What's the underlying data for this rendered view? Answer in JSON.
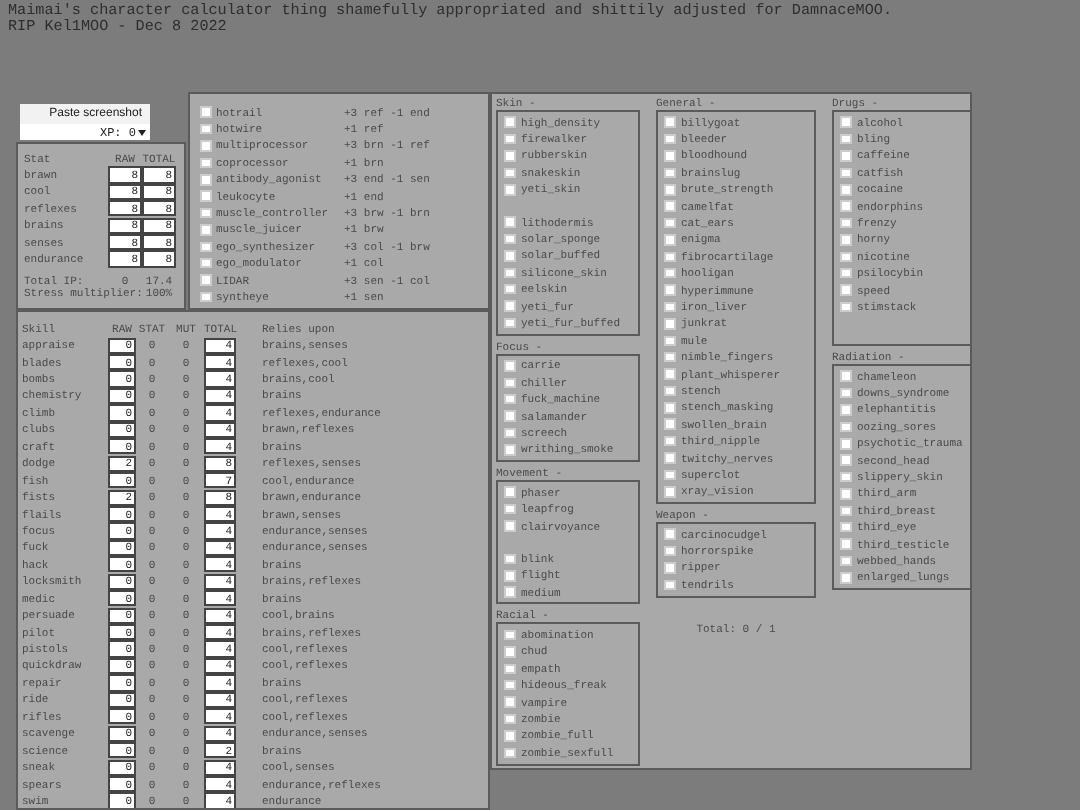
{
  "header": [
    "Maimai's character calculator thing shamefully appropriated and shittily adjusted for DamnaceMOO.",
    "RIP Kel1MOO - Dec 8 2022"
  ],
  "paste_button": "Paste screenshot",
  "xp_select": {
    "value": "XP: 0"
  },
  "stats": {
    "columns": [
      "Stat",
      "RAW",
      "TOTAL"
    ],
    "rows": [
      {
        "name": "brawn",
        "raw": "8",
        "total": "8"
      },
      {
        "name": "cool",
        "raw": "8",
        "total": "8"
      },
      {
        "name": "reflexes",
        "raw": "8",
        "total": "8"
      },
      {
        "name": "brains",
        "raw": "8",
        "total": "8"
      },
      {
        "name": "senses",
        "raw": "8",
        "total": "8"
      },
      {
        "name": "endurance",
        "raw": "8",
        "total": "8"
      }
    ],
    "total_ip": {
      "label": "Total IP:",
      "raw": "0",
      "total": "17.4"
    },
    "stress": {
      "label": "Stress multiplier:",
      "value": "100%"
    }
  },
  "implants": [
    {
      "name": "hotrail",
      "effect": "+3 ref -1 end",
      "checked": false
    },
    {
      "name": "hotwire",
      "effect": "+1 ref",
      "checked": false
    },
    {
      "name": "multiprocessor",
      "effect": "+3 brn -1 ref",
      "checked": false
    },
    {
      "name": "coprocessor",
      "effect": "+1 brn",
      "checked": false
    },
    {
      "name": "antibody_agonist",
      "effect": "+3 end -1 sen",
      "checked": false
    },
    {
      "name": "leukocyte",
      "effect": "+1 end",
      "checked": false
    },
    {
      "name": "muscle_controller",
      "effect": "+3 brw -1 brn",
      "checked": false
    },
    {
      "name": "muscle_juicer",
      "effect": "+1 brw",
      "checked": false
    },
    {
      "name": "ego_synthesizer",
      "effect": "+3 col -1 brw",
      "checked": false
    },
    {
      "name": "ego_modulator",
      "effect": "+1 col",
      "checked": false
    },
    {
      "name": "LIDAR",
      "effect": "+3 sen -1 col",
      "checked": false
    },
    {
      "name": "syntheye",
      "effect": "+1 sen",
      "checked": false
    }
  ],
  "skills": {
    "columns": [
      "Skill",
      "RAW",
      "STAT",
      "MUT",
      "TOTAL",
      "Relies upon"
    ],
    "rows": [
      {
        "name": "appraise",
        "raw": "0",
        "stat": "0",
        "mut": "0",
        "total": "4",
        "relies": "brains,senses"
      },
      {
        "name": "blades",
        "raw": "0",
        "stat": "0",
        "mut": "0",
        "total": "4",
        "relies": "reflexes,cool"
      },
      {
        "name": "bombs",
        "raw": "0",
        "stat": "0",
        "mut": "0",
        "total": "4",
        "relies": "brains,cool"
      },
      {
        "name": "chemistry",
        "raw": "0",
        "stat": "0",
        "mut": "0",
        "total": "4",
        "relies": "brains"
      },
      {
        "name": "climb",
        "raw": "0",
        "stat": "0",
        "mut": "0",
        "total": "4",
        "relies": "reflexes,endurance"
      },
      {
        "name": "clubs",
        "raw": "0",
        "stat": "0",
        "mut": "0",
        "total": "4",
        "relies": "brawn,reflexes"
      },
      {
        "name": "craft",
        "raw": "0",
        "stat": "0",
        "mut": "0",
        "total": "4",
        "relies": "brains"
      },
      {
        "name": "dodge",
        "raw": "2",
        "stat": "0",
        "mut": "0",
        "total": "8",
        "relies": "reflexes,senses"
      },
      {
        "name": "fish",
        "raw": "0",
        "stat": "0",
        "mut": "0",
        "total": "7",
        "relies": "cool,endurance"
      },
      {
        "name": "fists",
        "raw": "2",
        "stat": "0",
        "mut": "0",
        "total": "8",
        "relies": "brawn,endurance"
      },
      {
        "name": "flails",
        "raw": "0",
        "stat": "0",
        "mut": "0",
        "total": "4",
        "relies": "brawn,senses"
      },
      {
        "name": "focus",
        "raw": "0",
        "stat": "0",
        "mut": "0",
        "total": "4",
        "relies": "endurance,senses"
      },
      {
        "name": "fuck",
        "raw": "0",
        "stat": "0",
        "mut": "0",
        "total": "4",
        "relies": "endurance,senses"
      },
      {
        "name": "hack",
        "raw": "0",
        "stat": "0",
        "mut": "0",
        "total": "4",
        "relies": "brains"
      },
      {
        "name": "locksmith",
        "raw": "0",
        "stat": "0",
        "mut": "0",
        "total": "4",
        "relies": "brains,reflexes"
      },
      {
        "name": "medic",
        "raw": "0",
        "stat": "0",
        "mut": "0",
        "total": "4",
        "relies": "brains"
      },
      {
        "name": "persuade",
        "raw": "0",
        "stat": "0",
        "mut": "0",
        "total": "4",
        "relies": "cool,brains"
      },
      {
        "name": "pilot",
        "raw": "0",
        "stat": "0",
        "mut": "0",
        "total": "4",
        "relies": "brains,reflexes"
      },
      {
        "name": "pistols",
        "raw": "0",
        "stat": "0",
        "mut": "0",
        "total": "4",
        "relies": "cool,reflexes"
      },
      {
        "name": "quickdraw",
        "raw": "0",
        "stat": "0",
        "mut": "0",
        "total": "4",
        "relies": "cool,reflexes"
      },
      {
        "name": "repair",
        "raw": "0",
        "stat": "0",
        "mut": "0",
        "total": "4",
        "relies": "brains"
      },
      {
        "name": "ride",
        "raw": "0",
        "stat": "0",
        "mut": "0",
        "total": "4",
        "relies": "cool,reflexes"
      },
      {
        "name": "rifles",
        "raw": "0",
        "stat": "0",
        "mut": "0",
        "total": "4",
        "relies": "cool,reflexes"
      },
      {
        "name": "scavenge",
        "raw": "0",
        "stat": "0",
        "mut": "0",
        "total": "4",
        "relies": "endurance,senses"
      },
      {
        "name": "science",
        "raw": "0",
        "stat": "0",
        "mut": "0",
        "total": "2",
        "relies": "brains"
      },
      {
        "name": "sneak",
        "raw": "0",
        "stat": "0",
        "mut": "0",
        "total": "4",
        "relies": "cool,senses"
      },
      {
        "name": "spears",
        "raw": "0",
        "stat": "0",
        "mut": "0",
        "total": "4",
        "relies": "endurance,reflexes"
      },
      {
        "name": "swim",
        "raw": "0",
        "stat": "0",
        "mut": "0",
        "total": "4",
        "relies": "endurance"
      }
    ]
  },
  "mutations": {
    "columns": [
      [
        {
          "label": "Skin -",
          "groups": [
            [
              {
                "name": "high_density",
                "checked": false
              },
              {
                "name": "firewalker",
                "checked": false
              },
              {
                "name": "rubberskin",
                "checked": false
              },
              {
                "name": "snakeskin",
                "checked": false
              },
              {
                "name": "yeti_skin",
                "checked": false
              }
            ],
            [
              {
                "name": "lithodermis",
                "checked": false
              },
              {
                "name": "solar_sponge",
                "checked": false
              },
              {
                "name": "solar_buffed",
                "checked": false
              },
              {
                "name": "silicone_skin",
                "checked": false
              },
              {
                "name": "eelskin",
                "checked": false
              },
              {
                "name": "yeti_fur",
                "checked": false
              },
              {
                "name": "yeti_fur_buffed",
                "checked": false
              }
            ]
          ]
        },
        {
          "label": "Focus -",
          "groups": [
            [
              {
                "name": "carrie",
                "checked": false
              },
              {
                "name": "chiller",
                "checked": false
              },
              {
                "name": "fuck_machine",
                "checked": false
              },
              {
                "name": "salamander",
                "checked": false
              },
              {
                "name": "screech",
                "checked": false
              },
              {
                "name": "writhing_smoke",
                "checked": false
              }
            ]
          ]
        },
        {
          "label": "Movement -",
          "groups": [
            [
              {
                "name": "phaser",
                "checked": false
              },
              {
                "name": "leapfrog",
                "checked": false
              },
              {
                "name": "clairvoyance",
                "checked": false
              }
            ],
            [
              {
                "name": "blink",
                "checked": false
              },
              {
                "name": "flight",
                "checked": false
              },
              {
                "name": "medium",
                "checked": false
              }
            ]
          ]
        },
        {
          "label": "Racial -",
          "groups": [
            [
              {
                "name": "abomination",
                "checked": false
              },
              {
                "name": "chud",
                "checked": false
              },
              {
                "name": "empath",
                "checked": false
              },
              {
                "name": "hideous_freak",
                "checked": false
              },
              {
                "name": "vampire",
                "checked": false
              },
              {
                "name": "zombie",
                "checked": false
              },
              {
                "name": "zombie_full",
                "checked": false
              },
              {
                "name": "zombie_sexfull",
                "checked": false
              }
            ]
          ]
        }
      ],
      [
        {
          "label": "General -",
          "groups": [
            [
              {
                "name": "billygoat",
                "checked": false
              },
              {
                "name": "bleeder",
                "checked": false
              },
              {
                "name": "bloodhound",
                "checked": false
              },
              {
                "name": "brainslug",
                "checked": false
              },
              {
                "name": "brute_strength",
                "checked": false
              },
              {
                "name": "camelfat",
                "checked": false
              },
              {
                "name": "cat_ears",
                "checked": false
              },
              {
                "name": "enigma",
                "checked": false
              },
              {
                "name": "fibrocartilage",
                "checked": false
              },
              {
                "name": "hooligan",
                "checked": false
              },
              {
                "name": "hyperimmune",
                "checked": false
              },
              {
                "name": "iron_liver",
                "checked": false
              },
              {
                "name": "junkrat",
                "checked": false
              },
              {
                "name": "mule",
                "checked": false
              },
              {
                "name": "nimble_fingers",
                "checked": false
              },
              {
                "name": "plant_whisperer",
                "checked": false
              },
              {
                "name": "stench",
                "checked": false
              },
              {
                "name": "stench_masking",
                "checked": false
              },
              {
                "name": "swollen_brain",
                "checked": false
              },
              {
                "name": "third_nipple",
                "checked": false
              },
              {
                "name": "twitchy_nerves",
                "checked": false
              },
              {
                "name": "superclot",
                "checked": false
              },
              {
                "name": "xray_vision",
                "checked": false
              }
            ]
          ]
        },
        {
          "label": "Weapon -",
          "groups": [
            [
              {
                "name": "carcinocudgel",
                "checked": false
              },
              {
                "name": "horrorspike",
                "checked": false
              },
              {
                "name": "ripper",
                "checked": false
              },
              {
                "name": "tendrils",
                "checked": false
              }
            ]
          ]
        }
      ],
      [
        {
          "label": "Drugs -",
          "groups": [
            [
              {
                "name": "alcohol",
                "checked": false
              },
              {
                "name": "bling",
                "checked": false
              },
              {
                "name": "caffeine",
                "checked": false
              },
              {
                "name": "catfish",
                "checked": false
              },
              {
                "name": "cocaine",
                "checked": false
              },
              {
                "name": "endorphins",
                "checked": false
              },
              {
                "name": "frenzy",
                "checked": false
              },
              {
                "name": "horny",
                "checked": false
              },
              {
                "name": "nicotine",
                "checked": false
              },
              {
                "name": "psilocybin",
                "checked": false
              },
              {
                "name": "speed",
                "checked": false
              },
              {
                "name": "stimstack",
                "checked": false
              }
            ]
          ]
        },
        {
          "label": "Radiation -",
          "groups": [
            [
              {
                "name": "chameleon",
                "checked": false
              },
              {
                "name": "downs_syndrome",
                "checked": false
              },
              {
                "name": "elephantitis",
                "checked": false
              },
              {
                "name": "oozing_sores",
                "checked": false
              },
              {
                "name": "psychotic_trauma",
                "checked": false
              },
              {
                "name": "second_head",
                "checked": false
              },
              {
                "name": "slippery_skin",
                "checked": false
              },
              {
                "name": "third_arm",
                "checked": false
              },
              {
                "name": "third_breast",
                "checked": false
              },
              {
                "name": "third_eye",
                "checked": false
              },
              {
                "name": "third_testicle",
                "checked": false
              },
              {
                "name": "webbed_hands",
                "checked": false
              },
              {
                "name": "enlarged_lungs",
                "checked": false
              }
            ]
          ]
        }
      ]
    ],
    "total": "Total: 0 / 1"
  }
}
